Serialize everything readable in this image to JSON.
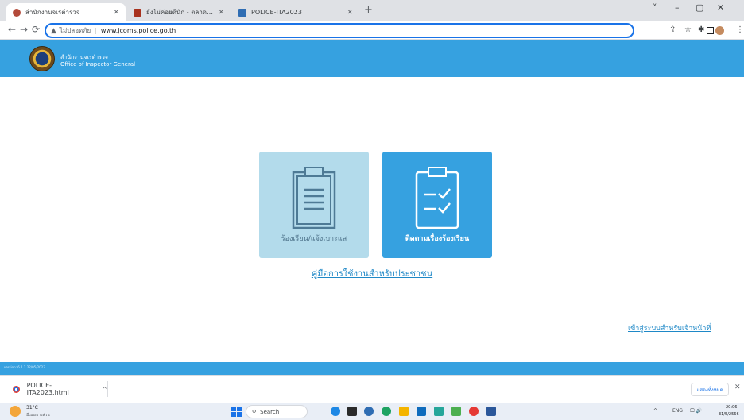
{
  "browser": {
    "tabs": [
      {
        "title": "สำนักงานจเรตำรวจ",
        "active": true,
        "favicon_color": "#b34a3a"
      },
      {
        "title": "ยังไม่ค่อยดีนัก - ตลาดนัดท่าทรายคุณป้า...",
        "active": false,
        "favicon_color": "#a8321e"
      },
      {
        "title": "POLICE-ITA2023",
        "active": false,
        "favicon_color": "#2f6db3"
      }
    ],
    "new_tab_icon": "plus-icon",
    "window_controls": {
      "dropdown": "˅",
      "minimize": "–",
      "maximize": "▢",
      "close": "✕"
    },
    "nav": {
      "back": "←",
      "forward": "→",
      "reload": "⟳"
    },
    "omnibox": {
      "security_icon": "warning-triangle-icon",
      "security_text": "ไม่ปลอดภัย",
      "url": "www.jcoms.police.go.th"
    },
    "toolbar_icons": [
      "share-icon",
      "star-icon",
      "extensions-icon",
      "sidebar-icon",
      "profile-icon",
      "menu-icon"
    ]
  },
  "site": {
    "header": {
      "org_name_th": "สำนักงานจเรตำรวจ",
      "org_name_en": "Office of Inspector General"
    },
    "cards": {
      "complaint_label": "ร้องเรียน/แจ้งเบาะแส",
      "track_label": "ติดตามเรื่องร้องเรียน"
    },
    "manual_link": "คู่มือการใช้งานสำหรับประชาชน",
    "officer_login_link": "เข้าสู่ระบบสำหรับเจ้าหน้าที่",
    "footer": {
      "version": "version: 6.1.2 22/05/2023"
    },
    "colors": {
      "primary": "#36a1e0",
      "card_inactive": "#b3dbeb",
      "link": "#1e88c7"
    }
  },
  "downloads": {
    "file_name": "POLICE-ITA2023.html",
    "show_all": "แสดงทั้งหมด",
    "close": "✕"
  },
  "taskbar": {
    "weather": {
      "temp": "31°C",
      "desc": "มีเมฆบางส่วน"
    },
    "search_placeholder": "Search",
    "app_colors": [
      "#1e88e5",
      "#2b2b2b",
      "#2f6db3",
      "#1ea362",
      "#f4b400",
      "#0f6cbd",
      "#26a69a",
      "#4caf50",
      "#e53935",
      "#2b579a"
    ],
    "tray": {
      "chevron": "^",
      "lang": "ENG",
      "icons": "🖵 🔊"
    },
    "clock": {
      "time": "20:06",
      "date": "31/5/2566"
    }
  }
}
